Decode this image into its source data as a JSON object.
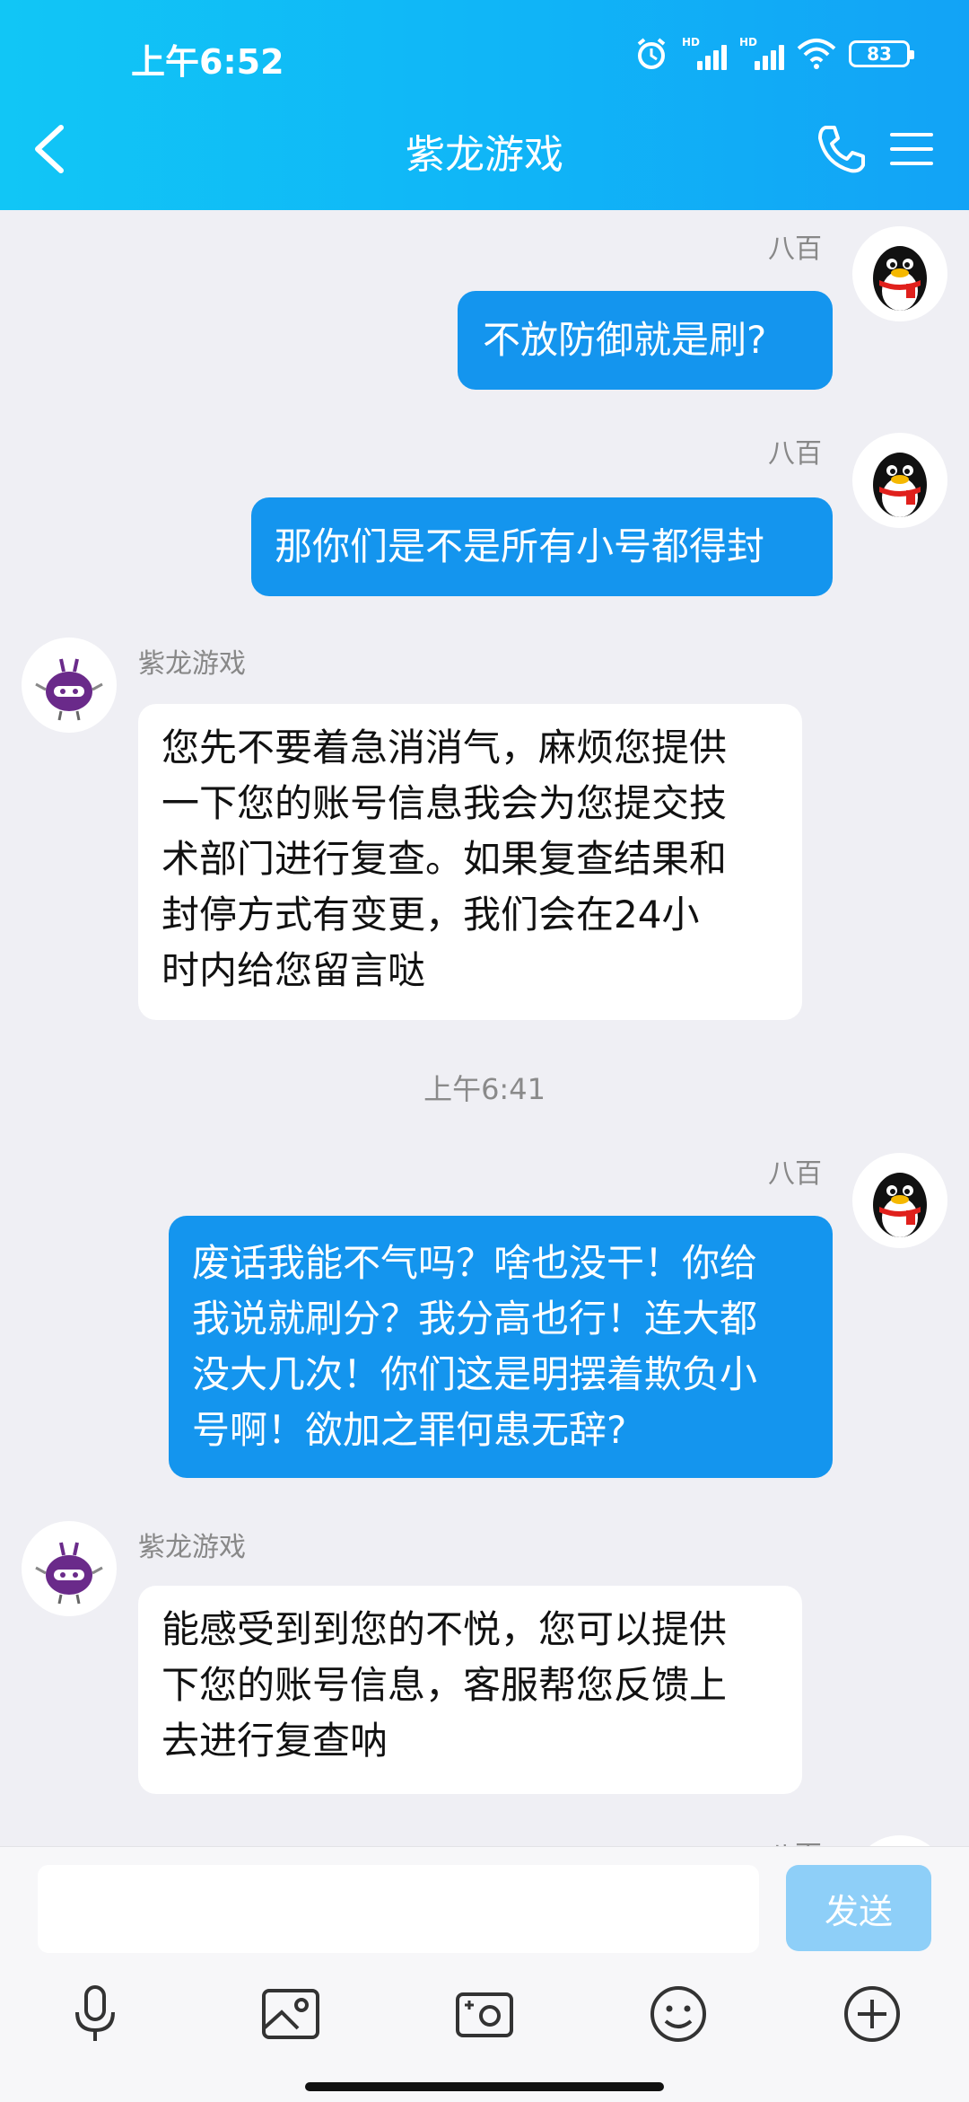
{
  "status": {
    "time": "上午6:52",
    "hd1": "HD",
    "hd2": "HD",
    "battery": "83"
  },
  "header": {
    "title": "紫龙游戏"
  },
  "chat": {
    "m1": {
      "name": "八百",
      "text": "不放防御就是刷?"
    },
    "m2": {
      "name": "八百",
      "text": "那你们是不是所有小号都得封"
    },
    "m3": {
      "name": "紫龙游戏",
      "text": "您先不要着急消消气，麻烦您提供\n一下您的账号信息我会为您提交技\n术部门进行复查。如果复查结果和\n封停方式有变更，我们会在24小\n时内给您留言哒"
    },
    "timestamp": "上午6:41",
    "m4": {
      "name": "八百",
      "text": "废话我能不气吗？啥也没干！你给\n我说就刷分？我分高也行！连大都\n没大几次！你们这是明摆着欺负小\n号啊！欲加之罪何患无辞?"
    },
    "m5": {
      "name": "紫龙游戏",
      "text": "能感受到到您的不悦，您可以提供\n下您的账号信息，客服帮您反馈上\n去进行复查呐"
    },
    "m6": {
      "name": "八百"
    }
  },
  "input": {
    "value": "",
    "send_label": "发送"
  },
  "icons": [
    "back-arrow-icon",
    "phone-icon",
    "menu-icon",
    "microphone-icon",
    "image-icon",
    "camera-icon",
    "emoji-icon",
    "plus-icon"
  ]
}
